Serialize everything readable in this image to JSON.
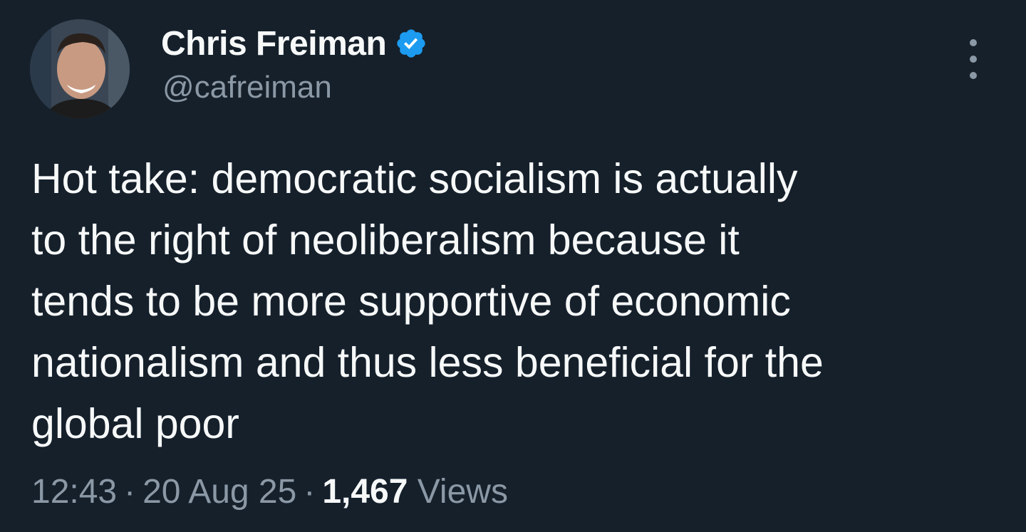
{
  "author": {
    "name": "Chris Freiman",
    "handle": "@cafreiman",
    "verified": true,
    "avatar_icon": "person-avatar"
  },
  "tweet": {
    "text": "Hot take: democratic socialism is actually\nto the right of neoliberalism because it\ntends to be more supportive of economic\nnationalism and thus less beneficial for the\nglobal poor",
    "time": "12:43",
    "separator": "·",
    "date": "20 Aug 25",
    "views_count": "1,467",
    "views_label": "Views"
  },
  "icons": {
    "verified": "verified-badge-icon",
    "more": "more-options-icon"
  },
  "colors": {
    "background": "#15202b",
    "primary_text": "#f7f9f9",
    "secondary_text": "#8b98a5",
    "verified_blue": "#1d9bf0"
  }
}
